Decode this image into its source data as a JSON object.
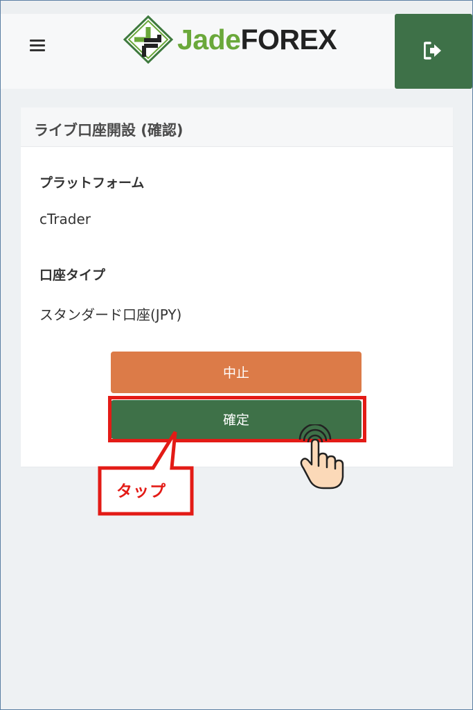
{
  "header": {
    "logo_jade": "Jade",
    "logo_forex": "FOREX"
  },
  "card": {
    "title": "ライブ口座開設 (確認)",
    "fields": [
      {
        "label": "プラットフォーム",
        "value": "cTrader"
      },
      {
        "label": "口座タイプ",
        "value": "スタンダード口座(JPY)"
      }
    ],
    "cancel_label": "中止",
    "confirm_label": "確定"
  },
  "annotation": {
    "tap_label": "タップ"
  },
  "colors": {
    "brand_green": "#3e7148",
    "logo_green": "#6aa83a",
    "cancel_orange": "#dc7b48",
    "highlight_red": "#e31b16"
  }
}
